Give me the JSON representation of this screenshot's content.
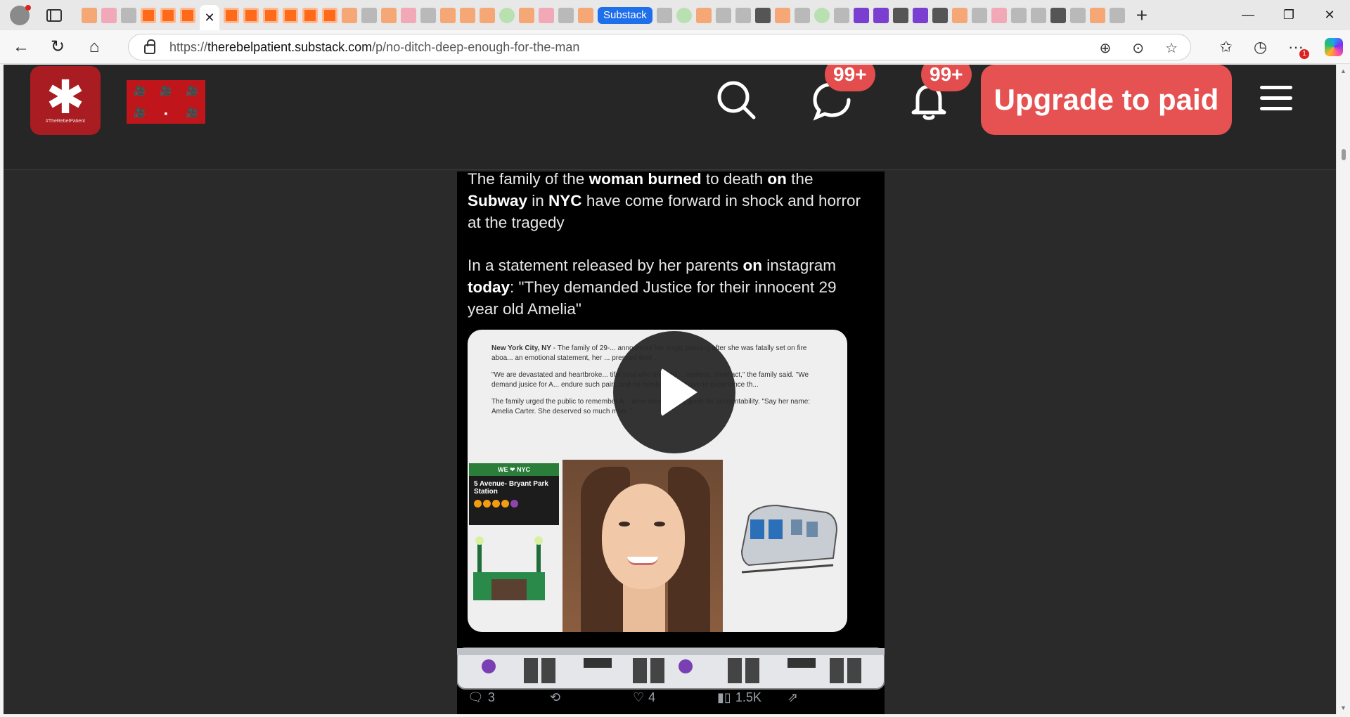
{
  "browser": {
    "tab_group_label": "Substack",
    "url_prefix": "https://",
    "url_host": "therebelpatient.substack.com",
    "url_path": "/p/no-ditch-deep-enough-for-the-man",
    "more_badge": "1"
  },
  "icons": {
    "profile": "profile-icon",
    "back": "back-arrow-icon",
    "refresh": "refresh-icon",
    "home": "home-icon",
    "zoom": "zoom-icon",
    "favorite": "star-icon"
  },
  "site": {
    "logo_caption": "#TheRebelPatient",
    "messages_badge": "99+",
    "notifications_badge": "99+",
    "upgrade_label": "Upgrade to paid",
    "accent_color": "#e65151"
  },
  "post": {
    "para1": {
      "t1": "The family of the ",
      "b1": "woman burned",
      "t2": " to death ",
      "b2": "on",
      "t3": " the ",
      "b3": "Subway",
      "t4": " in ",
      "b4": "NYC",
      "t5": " have come forward in shock and horror at the tragedy"
    },
    "para2": {
      "t1": "In a statement released by her parents ",
      "b1": "on",
      "t2": " instagram ",
      "b2": "today",
      "t3": ": \"They demanded Justice for their innocent 29 year old  Amelia\""
    },
    "article": {
      "dateline": "New York City, NY",
      "p1": " - The family of 29-... announced her tragic passing after she was fatally set on fire aboa... an emotional statement, her ... pressed their ...",
      "p2": "\"We are devastated and heartbroke... tiful soul who brought ... nseless, cruel act,\" the family said. \"We demand jusice for A... endure such pain, and no family should have to experience th...",
      "p3": "The family urged the public to remember A... ame alive as they push for accountability. \"Say her name: Amelia Carter. She deserved so much more.\""
    },
    "station": {
      "top": "WE ❤ NYC",
      "name": "5 Avenue- Bryant Park Station"
    },
    "stats": {
      "replies": "3",
      "likes": "4",
      "views": "1.5K"
    }
  }
}
